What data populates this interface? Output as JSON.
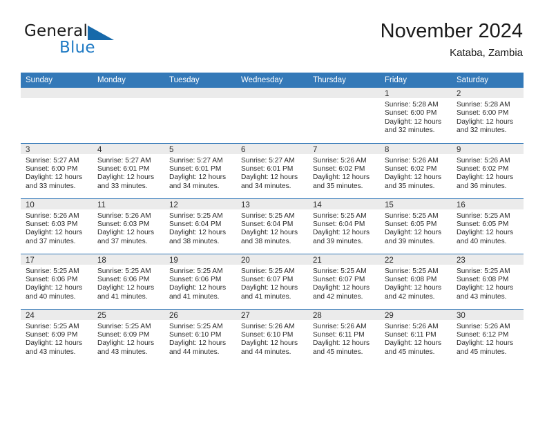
{
  "brand": {
    "name_part1": "General",
    "name_part2": "Blue",
    "flag_icon": "triangle-flag-icon"
  },
  "header": {
    "title": "November 2024",
    "subtitle": "Kataba, Zambia"
  },
  "calendar": {
    "weekday_headers": [
      "Sunday",
      "Monday",
      "Tuesday",
      "Wednesday",
      "Thursday",
      "Friday",
      "Saturday"
    ],
    "accent_color": "#3479b8",
    "band_color": "#ebebeb",
    "weeks": [
      [
        {
          "day": "",
          "empty": true
        },
        {
          "day": "",
          "empty": true
        },
        {
          "day": "",
          "empty": true
        },
        {
          "day": "",
          "empty": true
        },
        {
          "day": "",
          "empty": true
        },
        {
          "day": "1",
          "sunrise": "Sunrise: 5:28 AM",
          "sunset": "Sunset: 6:00 PM",
          "daylight1": "Daylight: 12 hours",
          "daylight2": "and 32 minutes."
        },
        {
          "day": "2",
          "sunrise": "Sunrise: 5:28 AM",
          "sunset": "Sunset: 6:00 PM",
          "daylight1": "Daylight: 12 hours",
          "daylight2": "and 32 minutes."
        }
      ],
      [
        {
          "day": "3",
          "sunrise": "Sunrise: 5:27 AM",
          "sunset": "Sunset: 6:00 PM",
          "daylight1": "Daylight: 12 hours",
          "daylight2": "and 33 minutes."
        },
        {
          "day": "4",
          "sunrise": "Sunrise: 5:27 AM",
          "sunset": "Sunset: 6:01 PM",
          "daylight1": "Daylight: 12 hours",
          "daylight2": "and 33 minutes."
        },
        {
          "day": "5",
          "sunrise": "Sunrise: 5:27 AM",
          "sunset": "Sunset: 6:01 PM",
          "daylight1": "Daylight: 12 hours",
          "daylight2": "and 34 minutes."
        },
        {
          "day": "6",
          "sunrise": "Sunrise: 5:27 AM",
          "sunset": "Sunset: 6:01 PM",
          "daylight1": "Daylight: 12 hours",
          "daylight2": "and 34 minutes."
        },
        {
          "day": "7",
          "sunrise": "Sunrise: 5:26 AM",
          "sunset": "Sunset: 6:02 PM",
          "daylight1": "Daylight: 12 hours",
          "daylight2": "and 35 minutes."
        },
        {
          "day": "8",
          "sunrise": "Sunrise: 5:26 AM",
          "sunset": "Sunset: 6:02 PM",
          "daylight1": "Daylight: 12 hours",
          "daylight2": "and 35 minutes."
        },
        {
          "day": "9",
          "sunrise": "Sunrise: 5:26 AM",
          "sunset": "Sunset: 6:02 PM",
          "daylight1": "Daylight: 12 hours",
          "daylight2": "and 36 minutes."
        }
      ],
      [
        {
          "day": "10",
          "sunrise": "Sunrise: 5:26 AM",
          "sunset": "Sunset: 6:03 PM",
          "daylight1": "Daylight: 12 hours",
          "daylight2": "and 37 minutes."
        },
        {
          "day": "11",
          "sunrise": "Sunrise: 5:26 AM",
          "sunset": "Sunset: 6:03 PM",
          "daylight1": "Daylight: 12 hours",
          "daylight2": "and 37 minutes."
        },
        {
          "day": "12",
          "sunrise": "Sunrise: 5:25 AM",
          "sunset": "Sunset: 6:04 PM",
          "daylight1": "Daylight: 12 hours",
          "daylight2": "and 38 minutes."
        },
        {
          "day": "13",
          "sunrise": "Sunrise: 5:25 AM",
          "sunset": "Sunset: 6:04 PM",
          "daylight1": "Daylight: 12 hours",
          "daylight2": "and 38 minutes."
        },
        {
          "day": "14",
          "sunrise": "Sunrise: 5:25 AM",
          "sunset": "Sunset: 6:04 PM",
          "daylight1": "Daylight: 12 hours",
          "daylight2": "and 39 minutes."
        },
        {
          "day": "15",
          "sunrise": "Sunrise: 5:25 AM",
          "sunset": "Sunset: 6:05 PM",
          "daylight1": "Daylight: 12 hours",
          "daylight2": "and 39 minutes."
        },
        {
          "day": "16",
          "sunrise": "Sunrise: 5:25 AM",
          "sunset": "Sunset: 6:05 PM",
          "daylight1": "Daylight: 12 hours",
          "daylight2": "and 40 minutes."
        }
      ],
      [
        {
          "day": "17",
          "sunrise": "Sunrise: 5:25 AM",
          "sunset": "Sunset: 6:06 PM",
          "daylight1": "Daylight: 12 hours",
          "daylight2": "and 40 minutes."
        },
        {
          "day": "18",
          "sunrise": "Sunrise: 5:25 AM",
          "sunset": "Sunset: 6:06 PM",
          "daylight1": "Daylight: 12 hours",
          "daylight2": "and 41 minutes."
        },
        {
          "day": "19",
          "sunrise": "Sunrise: 5:25 AM",
          "sunset": "Sunset: 6:06 PM",
          "daylight1": "Daylight: 12 hours",
          "daylight2": "and 41 minutes."
        },
        {
          "day": "20",
          "sunrise": "Sunrise: 5:25 AM",
          "sunset": "Sunset: 6:07 PM",
          "daylight1": "Daylight: 12 hours",
          "daylight2": "and 41 minutes."
        },
        {
          "day": "21",
          "sunrise": "Sunrise: 5:25 AM",
          "sunset": "Sunset: 6:07 PM",
          "daylight1": "Daylight: 12 hours",
          "daylight2": "and 42 minutes."
        },
        {
          "day": "22",
          "sunrise": "Sunrise: 5:25 AM",
          "sunset": "Sunset: 6:08 PM",
          "daylight1": "Daylight: 12 hours",
          "daylight2": "and 42 minutes."
        },
        {
          "day": "23",
          "sunrise": "Sunrise: 5:25 AM",
          "sunset": "Sunset: 6:08 PM",
          "daylight1": "Daylight: 12 hours",
          "daylight2": "and 43 minutes."
        }
      ],
      [
        {
          "day": "24",
          "sunrise": "Sunrise: 5:25 AM",
          "sunset": "Sunset: 6:09 PM",
          "daylight1": "Daylight: 12 hours",
          "daylight2": "and 43 minutes."
        },
        {
          "day": "25",
          "sunrise": "Sunrise: 5:25 AM",
          "sunset": "Sunset: 6:09 PM",
          "daylight1": "Daylight: 12 hours",
          "daylight2": "and 43 minutes."
        },
        {
          "day": "26",
          "sunrise": "Sunrise: 5:25 AM",
          "sunset": "Sunset: 6:10 PM",
          "daylight1": "Daylight: 12 hours",
          "daylight2": "and 44 minutes."
        },
        {
          "day": "27",
          "sunrise": "Sunrise: 5:26 AM",
          "sunset": "Sunset: 6:10 PM",
          "daylight1": "Daylight: 12 hours",
          "daylight2": "and 44 minutes."
        },
        {
          "day": "28",
          "sunrise": "Sunrise: 5:26 AM",
          "sunset": "Sunset: 6:11 PM",
          "daylight1": "Daylight: 12 hours",
          "daylight2": "and 45 minutes."
        },
        {
          "day": "29",
          "sunrise": "Sunrise: 5:26 AM",
          "sunset": "Sunset: 6:11 PM",
          "daylight1": "Daylight: 12 hours",
          "daylight2": "and 45 minutes."
        },
        {
          "day": "30",
          "sunrise": "Sunrise: 5:26 AM",
          "sunset": "Sunset: 6:12 PM",
          "daylight1": "Daylight: 12 hours",
          "daylight2": "and 45 minutes."
        }
      ]
    ]
  }
}
